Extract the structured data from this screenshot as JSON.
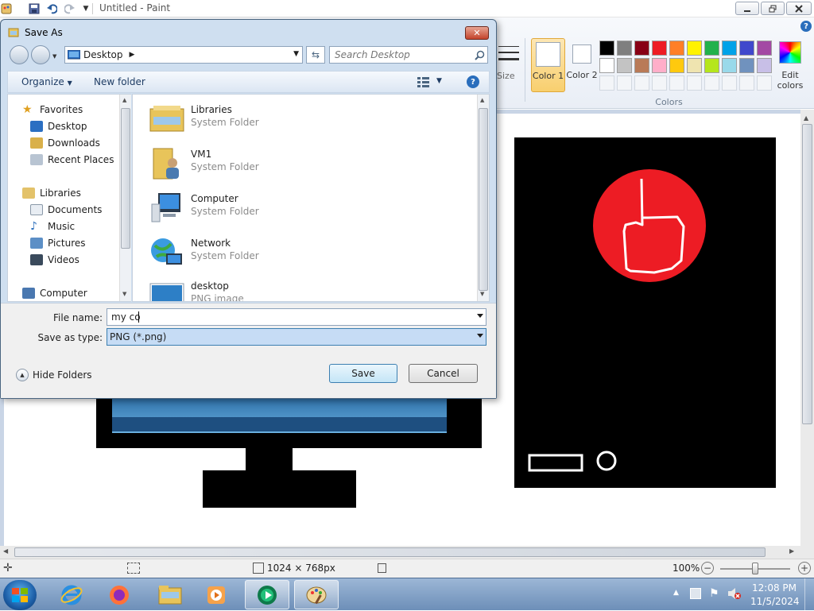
{
  "app": {
    "title": "Untitled - Paint",
    "window_buttons": [
      "minimize",
      "restore",
      "close"
    ]
  },
  "ribbon": {
    "size_label": "Size",
    "color1_label": "Color 1",
    "color2_label": "Color 2",
    "colors_group_label": "Colors",
    "edit_colors_label": "Edit colors",
    "palette_row1": [
      "#000000",
      "#7f7f7f",
      "#880015",
      "#ed1c24",
      "#ff7f27",
      "#fff200",
      "#22b14c",
      "#00a2e8",
      "#3f48cc",
      "#a349a4"
    ],
    "palette_row2": [
      "#ffffff",
      "#c3c3c3",
      "#b97a57",
      "#ffaec9",
      "#ffc90e",
      "#efe4b0",
      "#b5e61d",
      "#99d9ea",
      "#7092be",
      "#c8bfe7"
    ],
    "color1_value": "#ffffff",
    "color2_value": "#ffffff"
  },
  "dialog": {
    "title": "Save As",
    "address_location": "Desktop",
    "search_placeholder": "Search Desktop",
    "organize_label": "Organize",
    "new_folder_label": "New folder",
    "nav_tree": {
      "favorites_header": "Favorites",
      "favorites": [
        "Desktop",
        "Downloads",
        "Recent Places"
      ],
      "libraries_header": "Libraries",
      "libraries": [
        "Documents",
        "Music",
        "Pictures",
        "Videos"
      ],
      "computer_header": "Computer"
    },
    "files": [
      {
        "name": "Libraries",
        "type": "System Folder"
      },
      {
        "name": "VM1",
        "type": "System Folder"
      },
      {
        "name": "Computer",
        "type": "System Folder"
      },
      {
        "name": "Network",
        "type": "System Folder"
      },
      {
        "name": "desktop",
        "type": "PNG image"
      }
    ],
    "file_name_label": "File name:",
    "file_name_value": "my co",
    "save_as_type_label": "Save as type:",
    "save_as_type_value": "PNG (*.png)",
    "hide_folders_label": "Hide Folders",
    "save_button": "Save",
    "cancel_button": "Cancel"
  },
  "status_bar": {
    "dimensions": "1024 × 768px",
    "zoom": "100%"
  },
  "taskbar": {
    "time": "12:08 PM",
    "date": "11/5/2024"
  },
  "colors": {
    "circle_red": "#ed1c24",
    "drawing_black": "#000000"
  }
}
